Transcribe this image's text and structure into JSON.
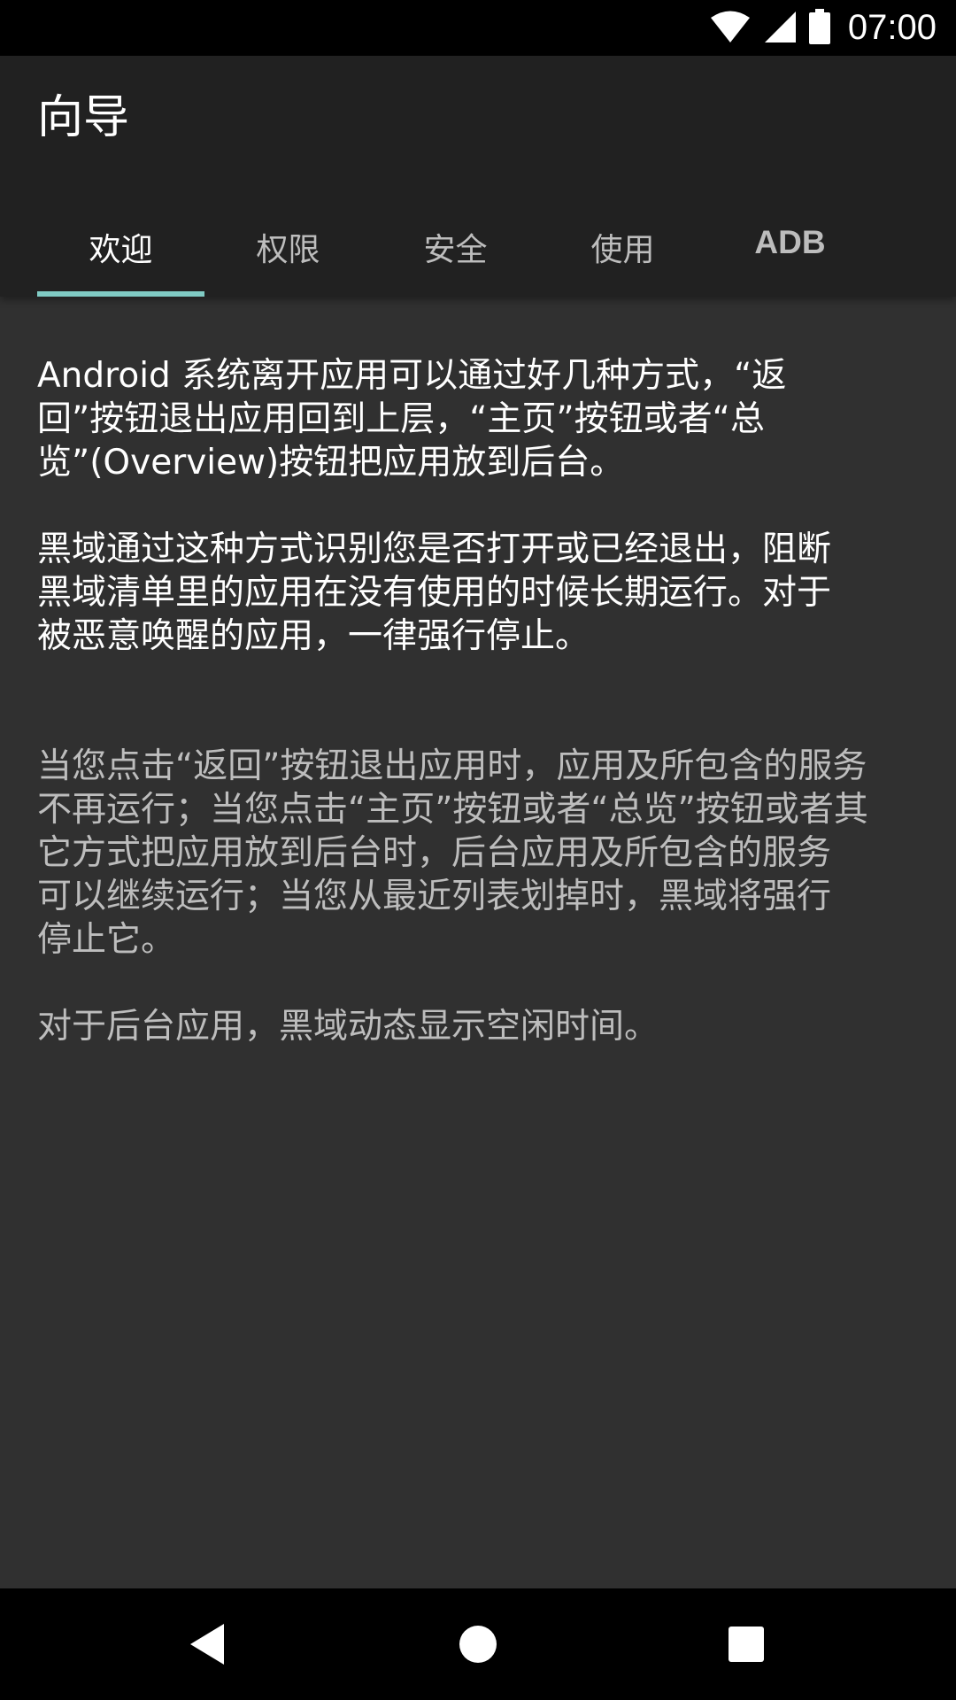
{
  "status_bar": {
    "time": "07:00",
    "icons": [
      "wifi-icon",
      "signal-icon",
      "battery-icon"
    ]
  },
  "app_bar": {
    "title": "向导"
  },
  "tabs": [
    {
      "label": "欢迎",
      "active": true
    },
    {
      "label": "权限",
      "active": false
    },
    {
      "label": "安全",
      "active": false
    },
    {
      "label": "使用",
      "active": false
    },
    {
      "label": "ADB",
      "active": false
    }
  ],
  "content": {
    "paragraph_1": "Android 系统离开应用可以通过好几种方式，“返\n回”按钮退出应用回到上层，“主页”按钮或者“总\n览”(Overview)按钮把应用放到后台。",
    "paragraph_2": "黑域通过这种方式识别您是否打开或已经退出，阻断\n黑域清单里的应用在没有使用的时候长期运行。对于\n被恶意唤醒的应用，一律强行停止。",
    "paragraph_3": "当您点击“返回”按钮退出应用时，应用及所包含的服务\n不再运行；当您点击“主页”按钮或者“总览”按钮或者其\n它方式把应用放到后台时，后台应用及所包含的服务\n可以继续运行；当您从最近列表划掉时，黑域将强行\n停止它。",
    "paragraph_4": "对于后台应用，黑域动态显示空闲时间。"
  },
  "nav_bar": {
    "buttons": [
      "back-icon",
      "home-icon",
      "recents-icon"
    ]
  },
  "colors": {
    "background": "#303030",
    "app_bar": "#212121",
    "accent": "#80cbc4",
    "text_primary": "#ffffff",
    "text_secondary": "#bdbdbd"
  }
}
